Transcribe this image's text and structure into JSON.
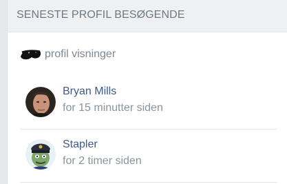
{
  "card": {
    "title": "SENESTE PROFIL BESØGENDE",
    "views_label": "profil visninger",
    "redacted_icon": "redacted-scribble"
  },
  "visitors": [
    {
      "name": "Bryan Mills",
      "time": "for 15 minutter siden",
      "avatar_icon": "person-avatar"
    },
    {
      "name": "Stapler",
      "time": "for 2 timer siden",
      "avatar_icon": "cartoon-police-avatar"
    }
  ],
  "colors": {
    "header_bg": "#eef0f2",
    "name_link": "#3b5a8a",
    "muted_text": "#8a939c"
  }
}
